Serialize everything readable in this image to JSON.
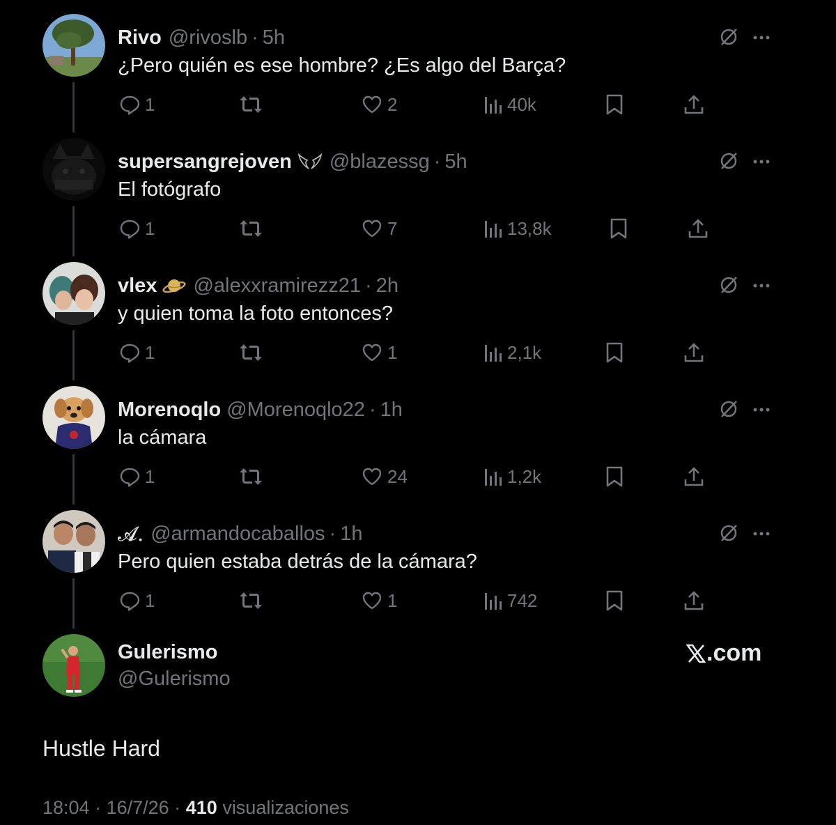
{
  "replies": [
    {
      "name": "Rivo",
      "handle": "@rivoslb",
      "time": "5h",
      "text": "¿Pero quién es ese hombre? ¿Es algo del Barça?",
      "replies": "1",
      "retweets": "",
      "likes": "2",
      "views": "40k"
    },
    {
      "name": "supersangrejoven",
      "handle": "@blazessg",
      "time": "5h",
      "text": "El fotógrafo",
      "replies": "1",
      "retweets": "",
      "likes": "7",
      "views": "13,8k"
    },
    {
      "name": "vlex",
      "handle": "@alexxramirezz21",
      "time": "2h",
      "text": "y quien toma la foto entonces?",
      "replies": "1",
      "retweets": "",
      "likes": "1",
      "views": "2,1k"
    },
    {
      "name": "Morenoqlo",
      "handle": "@Morenoqlo22",
      "time": "1h",
      "text": "la cámara",
      "replies": "1",
      "retweets": "",
      "likes": "24",
      "views": "1,2k"
    },
    {
      "name": "𝓐.",
      "handle": "@armandocaballos",
      "time": "1h",
      "text": "Pero quien estaba detrás de la cámara?",
      "replies": "1",
      "retweets": "",
      "likes": "1",
      "views": "742"
    }
  ],
  "separator": "·",
  "main": {
    "name": "Gulerismo",
    "handle": "@Gulerismo",
    "brand": ".com",
    "text": "Hustle Hard",
    "time": "18:04",
    "date": "16/7/26",
    "views": "410",
    "views_label": "visualizaciones"
  }
}
